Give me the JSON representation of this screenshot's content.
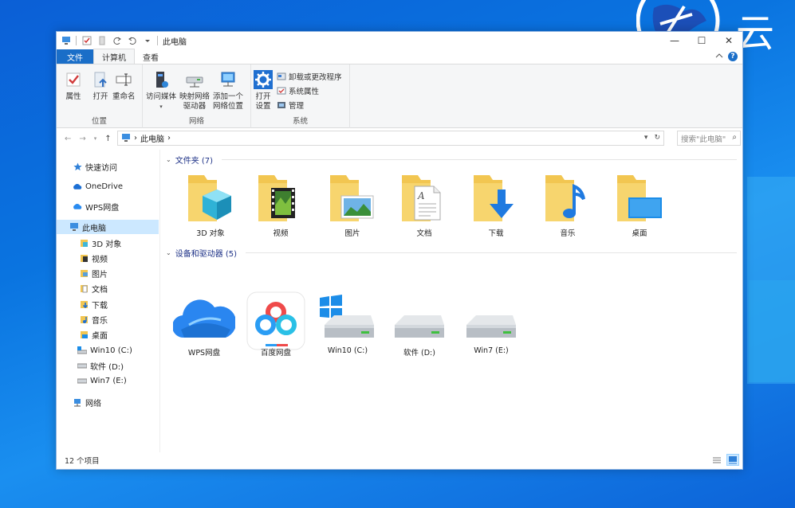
{
  "window": {
    "title": "此电脑",
    "minimize_glyph": "—",
    "maximize_glyph": "☐",
    "close_glyph": "✕"
  },
  "tabs": [
    {
      "label": "文件"
    },
    {
      "label": "计算机"
    },
    {
      "label": "查看"
    }
  ],
  "ribbon": {
    "location": {
      "label": "位置",
      "buttons": [
        {
          "label": "属性",
          "icon": "check-icon"
        },
        {
          "label": "打开",
          "icon": "open-icon"
        },
        {
          "label": "重命名",
          "icon": "rename-icon"
        }
      ]
    },
    "network": {
      "label": "网络",
      "buttons": [
        {
          "label": "访问媒体",
          "icon": "media-icon"
        },
        {
          "label": "映射网络驱动器",
          "line1": "映射网络",
          "line2": "驱动器",
          "icon": "map-drive-icon"
        },
        {
          "label": "添加一个网络位置",
          "line1": "添加一个",
          "line2": "网络位置",
          "icon": "add-network-location-icon"
        }
      ]
    },
    "system": {
      "label": "系统",
      "open_settings": {
        "line1": "打开",
        "line2": "设置",
        "icon": "settings-gear-icon"
      },
      "items": [
        {
          "label": "卸载或更改程序",
          "icon": "uninstall-icon"
        },
        {
          "label": "系统属性",
          "icon": "system-properties-icon"
        },
        {
          "label": "管理",
          "icon": "manage-icon"
        }
      ]
    }
  },
  "address": {
    "path": "此电脑",
    "separator": "›",
    "search_placeholder": "搜索\"此电脑\""
  },
  "nav_pane": {
    "quick_access": "快速访问",
    "onedrive": "OneDrive",
    "wps": "WPS网盘",
    "this_pc": "此电脑",
    "children": [
      "3D 对象",
      "视频",
      "图片",
      "文档",
      "下载",
      "音乐",
      "桌面",
      "Win10 (C:)",
      "软件 (D:)",
      "Win7 (E:)"
    ],
    "network": "网络"
  },
  "content": {
    "folders_header": "文件夹 (7)",
    "folders": [
      "3D 对象",
      "视频",
      "图片",
      "文档",
      "下载",
      "音乐",
      "桌面"
    ],
    "devices_header": "设备和驱动器 (5)",
    "devices": [
      "WPS网盘",
      "百度网盘",
      "Win10 (C:)",
      "软件 (D:)",
      "Win7 (E:)"
    ]
  },
  "status": {
    "item_count": "12 个项目"
  },
  "colors": {
    "accent": "#1a6ec8",
    "selection": "#cce8ff",
    "folder": "#f2c651",
    "header_text": "#1e3287"
  }
}
